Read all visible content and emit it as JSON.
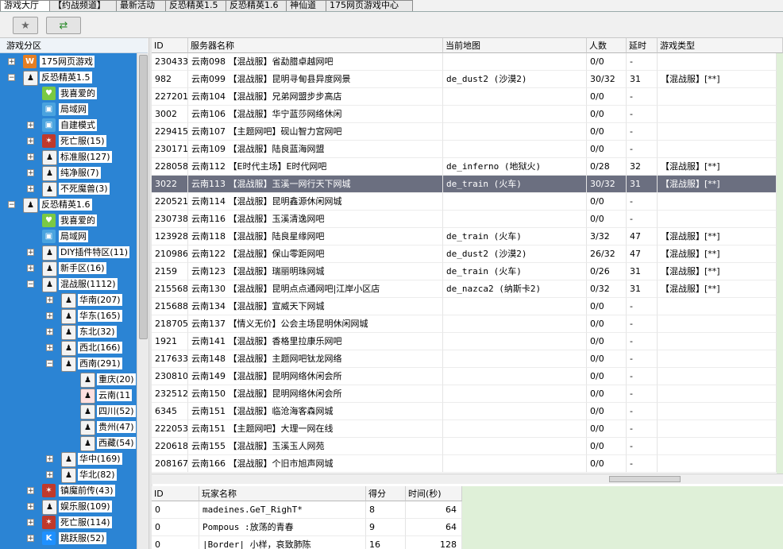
{
  "tabs": [
    {
      "label": "游戏大厅",
      "active": true
    },
    {
      "label": "【约战频道】",
      "active": false
    },
    {
      "label": "最新活动",
      "active": false
    },
    {
      "label": "反恐精英1.5",
      "active": false
    },
    {
      "label": "反恐精英1.6",
      "active": false
    },
    {
      "label": "神仙道",
      "active": false
    },
    {
      "label": "175网页游戏中心",
      "active": false
    }
  ],
  "toolbar": {
    "favorite_icon": "star-icon",
    "refresh_icon": "refresh-arrows-icon"
  },
  "sidebar": {
    "header": "游戏分区",
    "tree": [
      {
        "label": "175网页游戏",
        "expander": "+",
        "icon": "web-icon"
      },
      {
        "label": "反恐精英1.5",
        "expander": "-",
        "icon": "cs-icon"
      },
      {
        "label": "我喜爱的",
        "expander": "",
        "icon": "favorite-gift-icon"
      },
      {
        "label": "局域网",
        "expander": "",
        "icon": "lan-monitor-icon"
      },
      {
        "label": "自建模式",
        "expander": "+",
        "icon": "lan-monitor-icon"
      },
      {
        "label": "死亡服(15)",
        "expander": "+",
        "icon": "death-server-icon"
      },
      {
        "label": "标准服(127)",
        "expander": "+",
        "icon": "cs-icon"
      },
      {
        "label": "纯净服(7)",
        "expander": "+",
        "icon": "cs-icon"
      },
      {
        "label": "不死魔兽(3)",
        "expander": "+",
        "icon": "cs-icon"
      },
      {
        "label": "反恐精英1.6",
        "expander": "-",
        "icon": "cs-icon"
      },
      {
        "label": "我喜爱的",
        "expander": "",
        "icon": "favorite-gift-icon"
      },
      {
        "label": "局域网",
        "expander": "",
        "icon": "lan-monitor-icon"
      },
      {
        "label": "DIY插件特区(11)",
        "expander": "+",
        "icon": "cs-icon"
      },
      {
        "label": "新手区(16)",
        "expander": "+",
        "icon": "cs-icon"
      },
      {
        "label": "混战服(1112)",
        "expander": "-",
        "icon": "cs-icon"
      },
      {
        "label": "华南(207)",
        "expander": "+",
        "icon": "cs-icon"
      },
      {
        "label": "华东(165)",
        "expander": "+",
        "icon": "cs-icon"
      },
      {
        "label": "东北(32)",
        "expander": "+",
        "icon": "cs-icon"
      },
      {
        "label": "西北(166)",
        "expander": "+",
        "icon": "cs-icon"
      },
      {
        "label": "西南(291)",
        "expander": "-",
        "icon": "cs-icon"
      },
      {
        "label": "重庆(20)",
        "expander": "",
        "icon": "cs-icon"
      },
      {
        "label": "云南(11",
        "expander": "",
        "icon": "cs-selected-icon"
      },
      {
        "label": "四川(52)",
        "expander": "",
        "icon": "cs-icon"
      },
      {
        "label": "贵州(47)",
        "expander": "",
        "icon": "cs-icon"
      },
      {
        "label": "西藏(54)",
        "expander": "",
        "icon": "cs-icon"
      },
      {
        "label": "华中(169)",
        "expander": "+",
        "icon": "cs-icon"
      },
      {
        "label": "华北(82)",
        "expander": "+",
        "icon": "cs-icon"
      },
      {
        "label": "镇魔前传(43)",
        "expander": "+",
        "icon": "death-server-icon"
      },
      {
        "label": "娱乐服(109)",
        "expander": "+",
        "icon": "cs-icon"
      },
      {
        "label": "死亡服(114)",
        "expander": "+",
        "icon": "death-server-icon"
      },
      {
        "label": "跳跃服(52)",
        "expander": "+",
        "icon": "kz-icon"
      }
    ]
  },
  "servers": {
    "columns": [
      "ID",
      "服务器名称",
      "当前地图",
      "人数",
      "延时",
      "游戏类型"
    ],
    "rows": [
      {
        "id": "230433",
        "name": "云南098 【混战服】省勐腊卓越网吧",
        "map": "",
        "players": "0/0",
        "ping": "-",
        "type": ""
      },
      {
        "id": "982",
        "name": "云南099 【混战服】昆明寻甸县异度网景",
        "map": "de_dust2 (沙漠2)",
        "players": "30/32",
        "ping": "31",
        "type": "【混战服】[**]"
      },
      {
        "id": "227201",
        "name": "云南104 【混战服】兄弟网盟步步高店",
        "map": "",
        "players": "0/0",
        "ping": "-",
        "type": ""
      },
      {
        "id": "3002",
        "name": "云南106 【混战服】华宁蓝莎网络休闲",
        "map": "",
        "players": "0/0",
        "ping": "-",
        "type": ""
      },
      {
        "id": "229415",
        "name": "云南107 【主题网吧】砚山智力宫网吧",
        "map": "",
        "players": "0/0",
        "ping": "-",
        "type": ""
      },
      {
        "id": "230171",
        "name": "云南109 【混战服】陆良蓝海网盟",
        "map": "",
        "players": "0/0",
        "ping": "-",
        "type": ""
      },
      {
        "id": "228058",
        "name": "云南112 【E时代主场】E时代网吧",
        "map": "de_inferno (地狱火)",
        "players": "0/28",
        "ping": "32",
        "type": "【混战服】[**]"
      },
      {
        "id": "3022",
        "name": "云南113 【混战服】玉溪一网行天下网城",
        "map": "de_train (火车)",
        "players": "30/32",
        "ping": "31",
        "type": "【混战服】[**]",
        "selected": true
      },
      {
        "id": "220521",
        "name": "云南114 【混战服】昆明鑫源休闲网城",
        "map": "",
        "players": "0/0",
        "ping": "-",
        "type": ""
      },
      {
        "id": "230738",
        "name": "云南116 【混战服】玉溪清逸网吧",
        "map": "",
        "players": "0/0",
        "ping": "-",
        "type": ""
      },
      {
        "id": "123928",
        "name": "云南118 【混战服】陆良星缘网吧",
        "map": "de_train (火车)",
        "players": "3/32",
        "ping": "47",
        "type": "【混战服】[**]"
      },
      {
        "id": "210986",
        "name": "云南122 【混战服】保山零距网吧",
        "map": "de_dust2 (沙漠2)",
        "players": "26/32",
        "ping": "47",
        "type": "【混战服】[**]"
      },
      {
        "id": "2159",
        "name": "云南123 【混战服】瑞丽明珠网城",
        "map": "de_train (火车)",
        "players": "0/26",
        "ping": "31",
        "type": "【混战服】[**]"
      },
      {
        "id": "215568",
        "name": "云南130 【混战服】昆明点点通网吧|江岸小区店",
        "map": "de_nazca2 (纳斯卡2)",
        "players": "0/32",
        "ping": "31",
        "type": "【混战服】[**]"
      },
      {
        "id": "215688",
        "name": "云南134 【混战服】宣威天下网城",
        "map": "",
        "players": "0/0",
        "ping": "-",
        "type": ""
      },
      {
        "id": "218705",
        "name": "云南137 【情义无价】公会主场昆明休闲网城",
        "map": "",
        "players": "0/0",
        "ping": "-",
        "type": ""
      },
      {
        "id": "1921",
        "name": "云南141 【混战服】香格里拉康乐网吧",
        "map": "",
        "players": "0/0",
        "ping": "-",
        "type": ""
      },
      {
        "id": "217633",
        "name": "云南148 【混战服】主题网吧钛龙网络",
        "map": "",
        "players": "0/0",
        "ping": "-",
        "type": ""
      },
      {
        "id": "230810",
        "name": "云南149 【混战服】昆明网络休闲会所",
        "map": "",
        "players": "0/0",
        "ping": "-",
        "type": ""
      },
      {
        "id": "232512",
        "name": "云南150 【混战服】昆明网络休闲会所",
        "map": "",
        "players": "0/0",
        "ping": "-",
        "type": ""
      },
      {
        "id": "6345",
        "name": "云南151 【混战服】临沧海客森网城",
        "map": "",
        "players": "0/0",
        "ping": "-",
        "type": ""
      },
      {
        "id": "222053",
        "name": "云南151 【主题网吧】大理一网在线",
        "map": "",
        "players": "0/0",
        "ping": "-",
        "type": ""
      },
      {
        "id": "220618",
        "name": "云南155 【混战服】玉溪玉人网苑",
        "map": "",
        "players": "0/0",
        "ping": "-",
        "type": ""
      },
      {
        "id": "208167",
        "name": "云南166 【混战服】个旧市旭声网城",
        "map": "",
        "players": "0/0",
        "ping": "-",
        "type": ""
      }
    ]
  },
  "players": {
    "columns": [
      "ID",
      "玩家名称",
      "得分",
      "时间(秒)"
    ],
    "rows": [
      {
        "id": "0",
        "name": "madeines.GeT_RighT*",
        "score": "8",
        "time": "64"
      },
      {
        "id": "0",
        "name": "Pompous      :放荡的青春",
        "score": "9",
        "time": "64"
      },
      {
        "id": "0",
        "name": "|Border|   小样，哀致肺陈",
        "score": "16",
        "time": "128"
      }
    ]
  },
  "colors": {
    "tree_bg": "#2b84d4",
    "selected_row": "#6b6f80",
    "green_strip": "#dff0d8"
  }
}
